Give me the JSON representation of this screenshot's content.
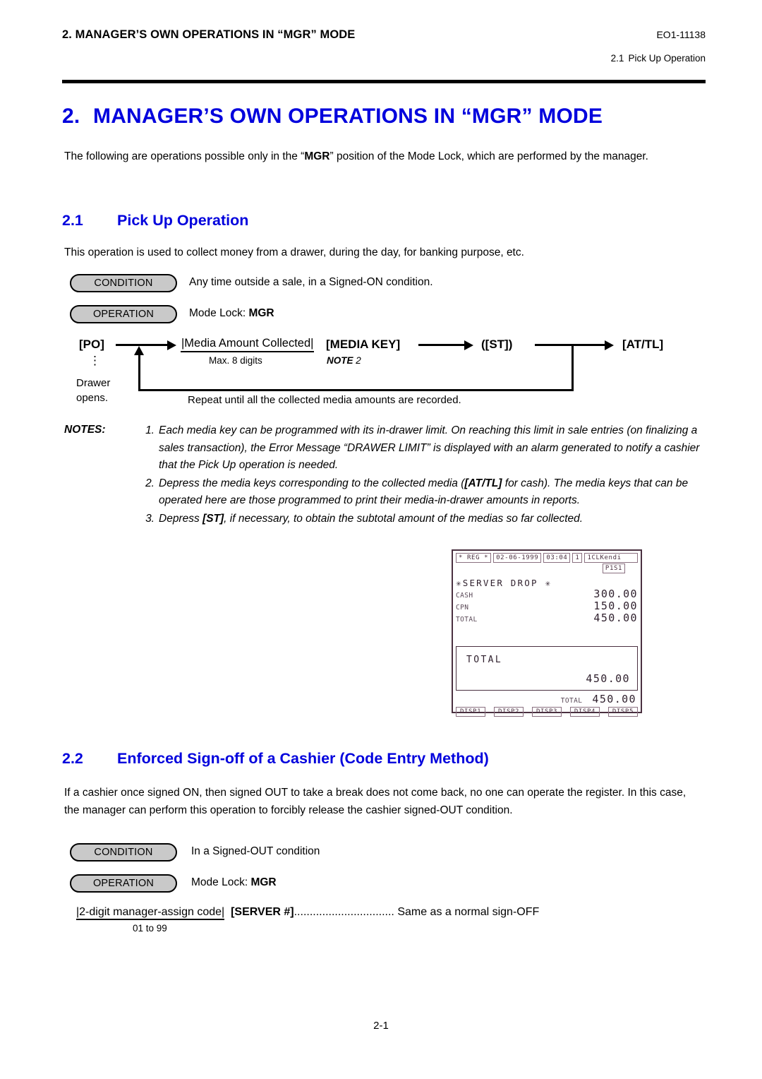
{
  "runhead": {
    "chapter_title": "2.  MANAGER’S OWN OPERATIONS IN “MGR” MODE",
    "doc_number": "EO1-11138",
    "section_number": "2.1",
    "section_title": "Pick Up Operation"
  },
  "headings": {
    "h1_number": "2.",
    "h1_text": "MANAGER’S OWN OPERATIONS IN “MGR” MODE",
    "h2_pickup_number": "2.1",
    "h2_pickup_text": "Pick Up Operation",
    "h2_signoff_number": "2.2",
    "h2_signoff_text": "Enforced Sign-off of a Cashier (Code Entry Method)"
  },
  "intro_paragraph": "The following are operations possible only in the “MGR” position of the Mode Lock, which are performed by the manager.",
  "intro_bold_term": "MGR",
  "pickup": {
    "paragraph": "This operation is used to collect money from a drawer, during the day, for banking purpose, etc.",
    "condition_label": "CONDITION",
    "condition_text": "Any time outside a sale, in a Signed-ON condition.",
    "operation_label": "OPERATION",
    "operation_text": "Mode Lock:",
    "operation_value": "MGR",
    "flow": {
      "po_key": "[PO]",
      "drawer_note_line1": "Drawer",
      "drawer_note_line2": "opens.",
      "media_amount": "|Media Amount Collected|",
      "media_amount_sub": "Max. 8 digits",
      "media_key": "[MEDIA KEY]",
      "media_key_note": "NOTE",
      "media_key_note_num": "2",
      "st_key": "([ST])",
      "attl_key": "[AT/TL]",
      "repeat_text": "Repeat until all the collected media amounts are recorded."
    }
  },
  "notes": {
    "label": "NOTES:",
    "items": [
      {
        "number": "1.",
        "text": "Each media key can be programmed with its in-drawer limit. On reaching this limit in sale entries (on finalizing a sales transaction), the Error Message “DRAWER LIMIT” is displayed with an alarm generated to notify a cashier that the Pick Up operation is needed."
      },
      {
        "number": "2.",
        "text": "Depress the media keys corresponding to the collected media ([AT/TL] for cash). The media keys that can be operated here are those programmed to print their media-in-drawer amounts in reports."
      },
      {
        "number": "3.",
        "text": "Depress [ST], if necessary, to obtain the subtotal amount of the medias so far collected."
      }
    ]
  },
  "receipt": {
    "mode": "* REG *",
    "date": "02-06-1999",
    "time": "03:04",
    "register": "1",
    "clerk": "1CLKendi",
    "page_status": "P1S1",
    "title": "✳SERVER  DROP  ✳",
    "lines": [
      {
        "key": "CASH",
        "value": "300.00"
      },
      {
        "key": "CPN",
        "value": "150.00"
      },
      {
        "key": "TOTAL",
        "value": "450.00"
      }
    ],
    "total_box_label": "TOTAL",
    "total_box_value": "450.00",
    "footer_key": "TOTAL",
    "footer_value": "450.00",
    "disp_buttons": [
      "DISP1",
      "DISP2",
      "DISP3",
      "DISP4",
      "DISP5"
    ],
    "border_color": "#4a3040"
  },
  "signoff": {
    "paragraph": "If a cashier once signed ON, then signed OUT to take a break does not come back, no one can operate the register. In this case, the manager can perform this operation to forcibly release the cashier signed-OUT condition.",
    "condition_label": "CONDITION",
    "condition_text": "In a Signed-OUT condition",
    "operation_label": "OPERATION",
    "operation_text": "Mode Lock:",
    "operation_value": "MGR",
    "entry_code": "|2-digit manager-assign code|",
    "entry_code_range": "01 to 99",
    "entry_key": "[SERVER #]",
    "entry_leader": "................................",
    "entry_result": "Same as a normal sign-OFF"
  },
  "footer": {
    "page_number": "2-1"
  },
  "colors": {
    "heading_blue": "#0000dd",
    "badge_grey": "#c9c9c9",
    "rule_black": "#000000"
  }
}
